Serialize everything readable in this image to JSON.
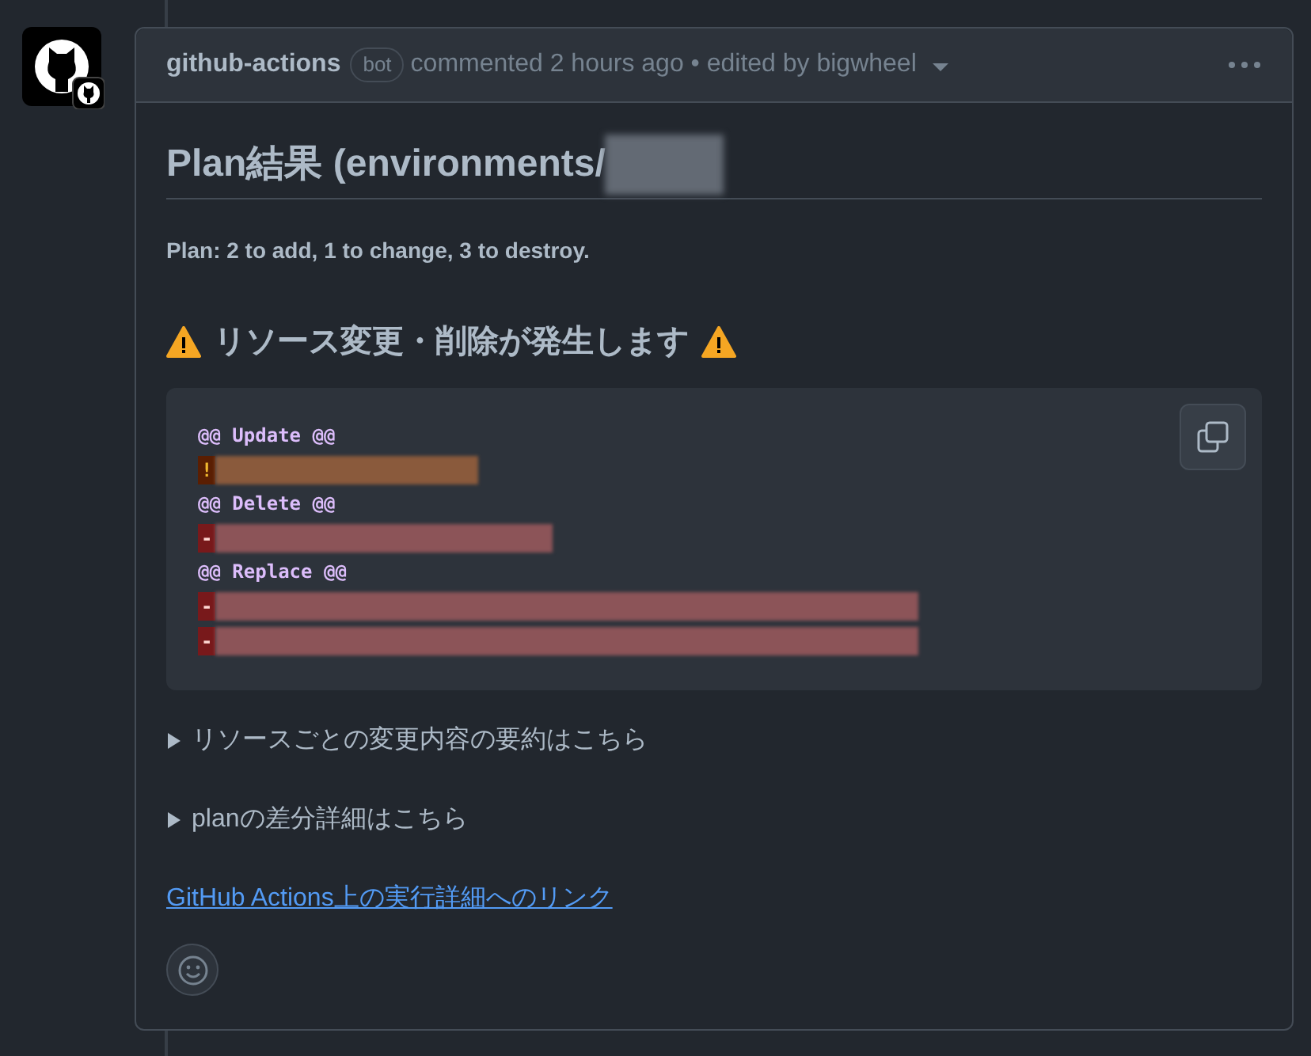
{
  "comment": {
    "author": "github-actions",
    "badge": "bot",
    "meta": "commented 2 hours ago • edited by bigwheel",
    "title": "Plan結果 (environments/",
    "summary": "Plan: 2 to add, 1 to change, 3 to destroy.",
    "warning_heading": "リソース変更・削除が発生します",
    "code_lines": [
      {
        "kind": "hunk",
        "text": "@@ Update @@"
      },
      {
        "kind": "change",
        "marker": "!"
      },
      {
        "kind": "hunk",
        "text": "@@ Delete @@"
      },
      {
        "kind": "delete",
        "marker": "-"
      },
      {
        "kind": "hunk",
        "text": "@@ Replace @@"
      },
      {
        "kind": "delete",
        "marker": "-"
      },
      {
        "kind": "delete",
        "marker": "-"
      }
    ],
    "details": [
      {
        "label": "リソースごとの変更内容の要約はこちら",
        "expanded": false
      },
      {
        "label": "planの差分詳細はこちら",
        "expanded": false
      }
    ],
    "link": "GitHub Actions上の実行詳細へのリンク"
  }
}
